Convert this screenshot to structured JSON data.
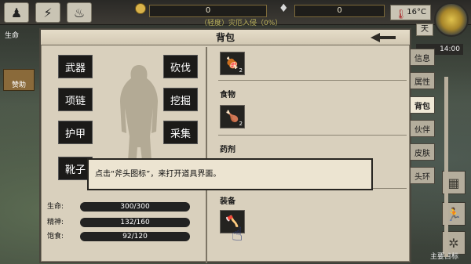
{
  "hud": {
    "left_label": "生命",
    "gold_value": "0",
    "gem_value": "0",
    "status_line": "（轻度）灾厄入侵（0%）",
    "temperature": "16°C",
    "day_label": "天",
    "time": "14:00",
    "trade_label": "赞助",
    "goal_label": "主要目标"
  },
  "panel": {
    "title": "背包",
    "equip_left": [
      "武器",
      "项链",
      "护甲",
      "靴子"
    ],
    "equip_right": [
      "砍伐",
      "挖掘",
      "采集"
    ],
    "stats": [
      {
        "label": "生命:",
        "value": "300/300"
      },
      {
        "label": "精神:",
        "value": "132/160"
      },
      {
        "label": "饱食:",
        "value": "92/120"
      }
    ],
    "sections": {
      "food": "食物",
      "medicine": "药剂",
      "equipment": "装备"
    },
    "item_counts": {
      "item1": "2",
      "item2": "2"
    }
  },
  "tabs": [
    "信息",
    "属性",
    "背包",
    "伙伴",
    "皮肤",
    "头环"
  ],
  "tooltip": {
    "text": "点击“斧头图标”，来打开道具界面。"
  },
  "colors": {
    "panel_bg": "#d9d0bd",
    "slot_bg": "#1b1a18",
    "bar_bg": "#222222",
    "gold": "#d9b34a"
  }
}
